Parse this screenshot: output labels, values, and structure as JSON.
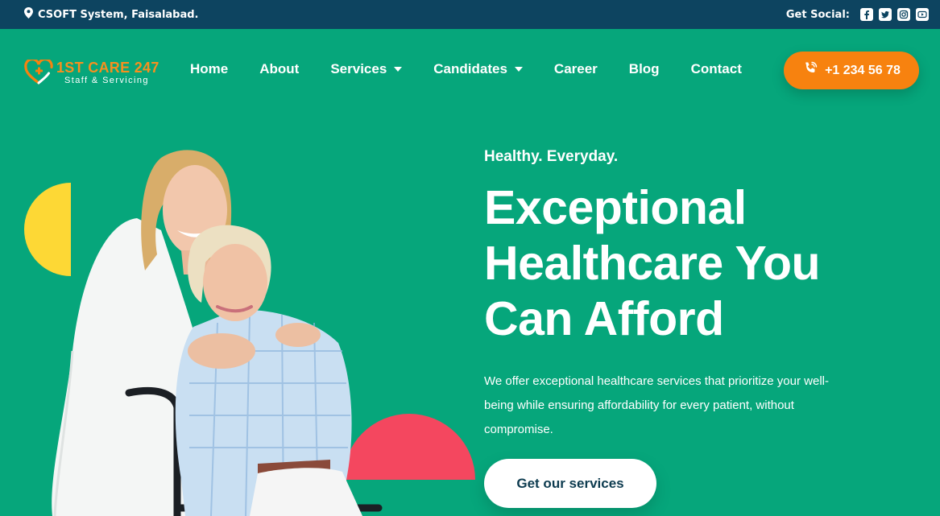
{
  "topbar": {
    "location": "CSOFT System, Faisalabad.",
    "social_label": "Get Social:",
    "social_icons": [
      "facebook-icon",
      "twitter-icon",
      "instagram-icon",
      "youtube-icon"
    ]
  },
  "logo": {
    "title": "1ST CARE 247",
    "subtitle": "Staff & Servicing"
  },
  "nav": {
    "items": [
      {
        "label": "Home"
      },
      {
        "label": "About"
      },
      {
        "label": "Services",
        "dropdown": true
      },
      {
        "label": "Candidates",
        "dropdown": true
      },
      {
        "label": "Career"
      },
      {
        "label": "Blog"
      },
      {
        "label": "Contact"
      }
    ]
  },
  "phone": {
    "label": "+1 234 56 78"
  },
  "hero": {
    "eyebrow": "Healthy. Everyday.",
    "headline": "Exceptional Healthcare You Can Afford",
    "description": "We offer exceptional healthcare services that prioritize your well-being while ensuring affordability for every patient, without compromise.",
    "cta_label": "Get our services"
  },
  "colors": {
    "background": "#06a67b",
    "topbar": "#0d4460",
    "accent_orange": "#f7820f",
    "shape_yellow": "#fdd835",
    "shape_red": "#f4475f",
    "cta_text": "#0d3b4f"
  }
}
